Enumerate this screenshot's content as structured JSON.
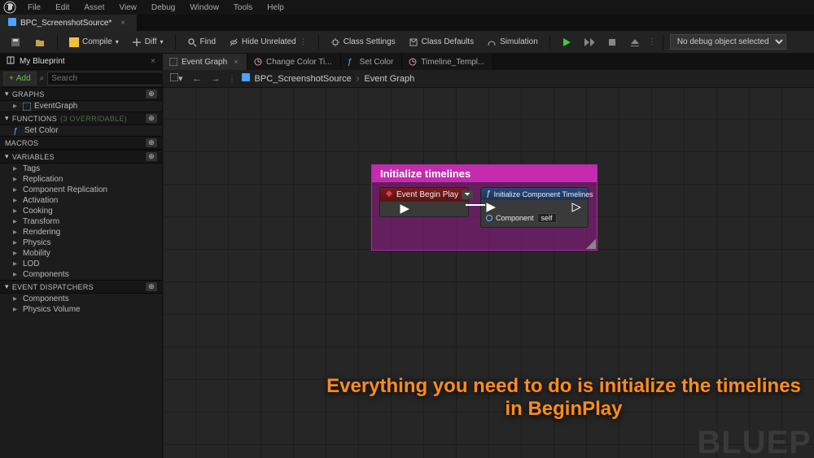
{
  "menu": {
    "items": [
      "File",
      "Edit",
      "Asset",
      "View",
      "Debug",
      "Window",
      "Tools",
      "Help"
    ]
  },
  "windowTab": {
    "title": "BPC_ScreenshotSource*"
  },
  "toolbar": {
    "save": "Save",
    "browse": "Browse",
    "compile": "Compile",
    "diff": "Diff",
    "find": "Find",
    "hideUnrel": "Hide Unrelated",
    "classSettings": "Class Settings",
    "classDefaults": "Class Defaults",
    "simulation": "Simulation",
    "debugDropdown": "No debug object selected"
  },
  "sidebar": {
    "title": "My Blueprint",
    "add": "Add",
    "searchPlaceholder": "Search",
    "sections": {
      "graphs": {
        "label": "GRAPHS",
        "items": [
          {
            "label": "EventGraph",
            "icon": "graph"
          }
        ]
      },
      "functions": {
        "label": "FUNCTIONS",
        "sub": "(3 OVERRIDABLE)",
        "items": [
          {
            "label": "Set Color",
            "icon": "func"
          }
        ]
      },
      "macros": {
        "label": "MACROS",
        "items": []
      },
      "variables": {
        "label": "VARIABLES",
        "items": [
          {
            "label": "Tags"
          },
          {
            "label": "Replication"
          },
          {
            "label": "Component Replication"
          },
          {
            "label": "Activation"
          },
          {
            "label": "Cooking"
          },
          {
            "label": "Transform"
          },
          {
            "label": "Rendering"
          },
          {
            "label": "Physics"
          },
          {
            "label": "Mobility"
          },
          {
            "label": "LOD"
          },
          {
            "label": "Components"
          }
        ]
      },
      "dispatchers": {
        "label": "EVENT DISPATCHERS",
        "items": [
          {
            "label": "Components"
          },
          {
            "label": "Physics Volume"
          }
        ]
      }
    }
  },
  "canvasTabs": [
    {
      "label": "Event Graph",
      "icon": "graph",
      "active": true,
      "closable": true
    },
    {
      "label": "Change Color Ti...",
      "icon": "timeline",
      "active": false,
      "closable": false
    },
    {
      "label": "Set Color",
      "icon": "func",
      "active": false,
      "closable": false
    },
    {
      "label": "Timeline_Templ...",
      "icon": "timeline",
      "active": false,
      "closable": false
    }
  ],
  "breadcrumb": {
    "root": "BPC_ScreenshotSource",
    "leaf": "Event Graph"
  },
  "comment": {
    "title": "Initialize timelines"
  },
  "nodes": {
    "begin": {
      "title": "Event Begin Play"
    },
    "init": {
      "title": "Initialize Component Timelines",
      "pinComponent": "Component",
      "pinSelf": "self"
    }
  },
  "caption": "Everything you need to do is initialize the timelines in BeginPlay",
  "watermark": "BLUEP"
}
